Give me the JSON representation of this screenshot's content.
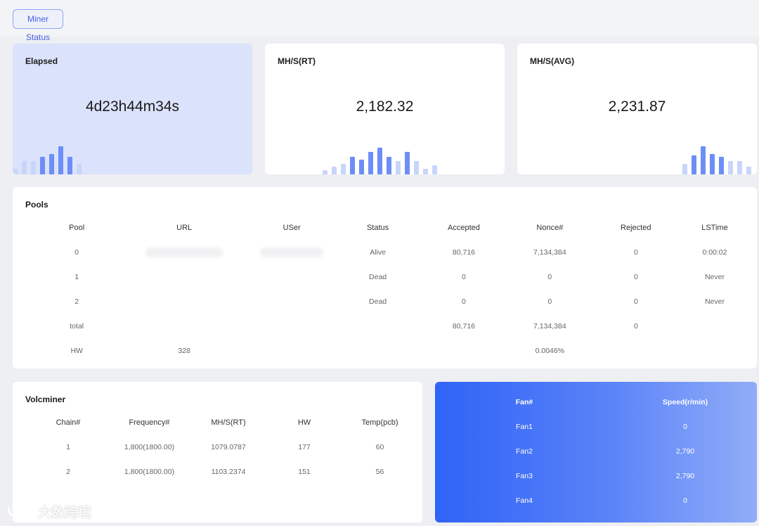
{
  "topbar": {
    "tab_label": "Miner Status"
  },
  "stats": [
    {
      "title": "Elapsed",
      "value": "4d23h44m34s",
      "spark": [
        0.2,
        0.45,
        0.45,
        0.6,
        0.7,
        0.95,
        0.6,
        0.35
      ],
      "active": true
    },
    {
      "title": "MH/S(RT)",
      "value": "2,182.32",
      "spark": [
        0.15,
        0.25,
        0.35,
        0.6,
        0.5,
        0.75,
        0.9,
        0.6,
        0.45,
        0.75,
        0.45,
        0.2,
        0.3
      ]
    },
    {
      "title": "MH/S(AVG)",
      "value": "2,231.87",
      "spark": [
        0.35,
        0.65,
        0.95,
        0.7,
        0.6,
        0.45,
        0.45,
        0.25
      ]
    }
  ],
  "pools": {
    "title": "Pools",
    "headers": [
      "Pool",
      "URL",
      "USer",
      "Status",
      "Accepted",
      "Nonce#",
      "Rejected",
      "LSTime"
    ],
    "rows": [
      [
        "0",
        "",
        "",
        "Alive",
        "80,716",
        "7,134,384",
        "0",
        "0:00:02"
      ],
      [
        "1",
        "",
        "",
        "Dead",
        "0",
        "0",
        "0",
        "Never"
      ],
      [
        "2",
        "",
        "",
        "Dead",
        "0",
        "0",
        "0",
        "Never"
      ],
      [
        "total",
        "",
        "",
        "",
        "80,716",
        "7,134,384",
        "0",
        ""
      ],
      [
        "HW",
        "328",
        "",
        "",
        "",
        "0.0046%",
        "",
        ""
      ]
    ]
  },
  "volcminer": {
    "title": "Volcminer",
    "headers": [
      "Chain#",
      "Frequency#",
      "MH/S(RT)",
      "HW",
      "Temp(pcb)"
    ],
    "rows": [
      [
        "1",
        "1,800(1800.00)",
        "1079.0787",
        "177",
        "60"
      ],
      [
        "2",
        "1,800(1800.00)",
        "1103.2374",
        "151",
        "56"
      ]
    ]
  },
  "fans": {
    "headers": [
      "Fan#",
      "Speed(r/min)"
    ],
    "rows": [
      [
        "Fan1",
        "0"
      ],
      [
        "Fan2",
        "2,790"
      ],
      [
        "Fan3",
        "2,790"
      ],
      [
        "Fan4",
        "0"
      ]
    ]
  },
  "watermark": {
    "text": "大数跨境"
  },
  "colors": {
    "accent": "#4662e6",
    "spark_strong": "#6d8ef7",
    "spark_light": "#c8d5fb",
    "fan_gradient_start": "#2f63f7",
    "fan_gradient_end": "#91acf7"
  }
}
